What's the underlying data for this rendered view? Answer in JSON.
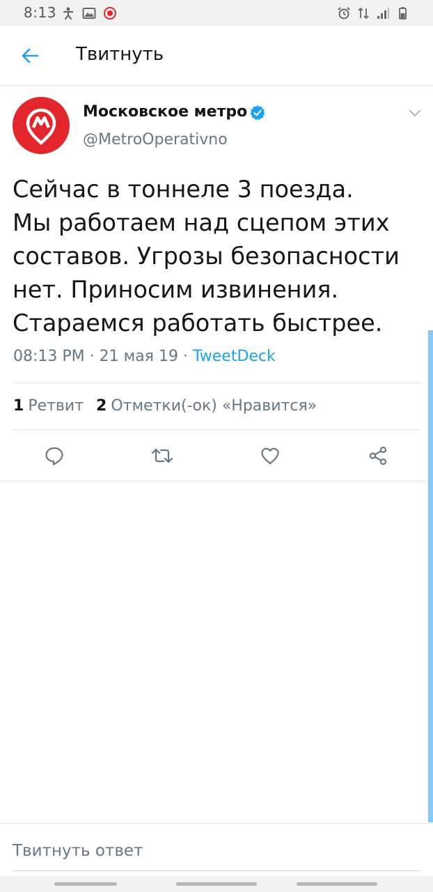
{
  "status_bar": {
    "time": "8:13",
    "left_icons": [
      "accessibility-icon",
      "image-icon",
      "app-notification-icon"
    ],
    "right_icons": [
      "alarm-icon",
      "data-arrows-icon",
      "signal-icon",
      "battery-icon"
    ]
  },
  "app_bar": {
    "title": "Твитнуть",
    "back_icon": "arrow-left-icon"
  },
  "tweet": {
    "author_name": "Московское метро",
    "author_handle": "@MetroOperativno",
    "verified": true,
    "text": "Сейчас в тоннеле 3 поезда.\nМы работаем над сцепом этих составов. Угрозы безопасности нет. Приносим извинения. Стараемся работать быстрее.",
    "time": "08:13 PM",
    "date": "21 мая 19",
    "separator": "·",
    "source": "TweetDeck"
  },
  "stats": {
    "retweets_count": "1",
    "retweets_label": "Ретвит",
    "likes_count": "2",
    "likes_label": "Отметки(-ок) «Нравится»"
  },
  "actions": [
    "reply-icon",
    "retweet-icon",
    "like-icon",
    "share-icon"
  ],
  "reply": {
    "placeholder": "Твитнуть ответ"
  },
  "colors": {
    "accent": "#1da1f2",
    "avatar_bg": "#e3262b",
    "secondary_text": "#657786",
    "primary_text": "#14171a"
  }
}
